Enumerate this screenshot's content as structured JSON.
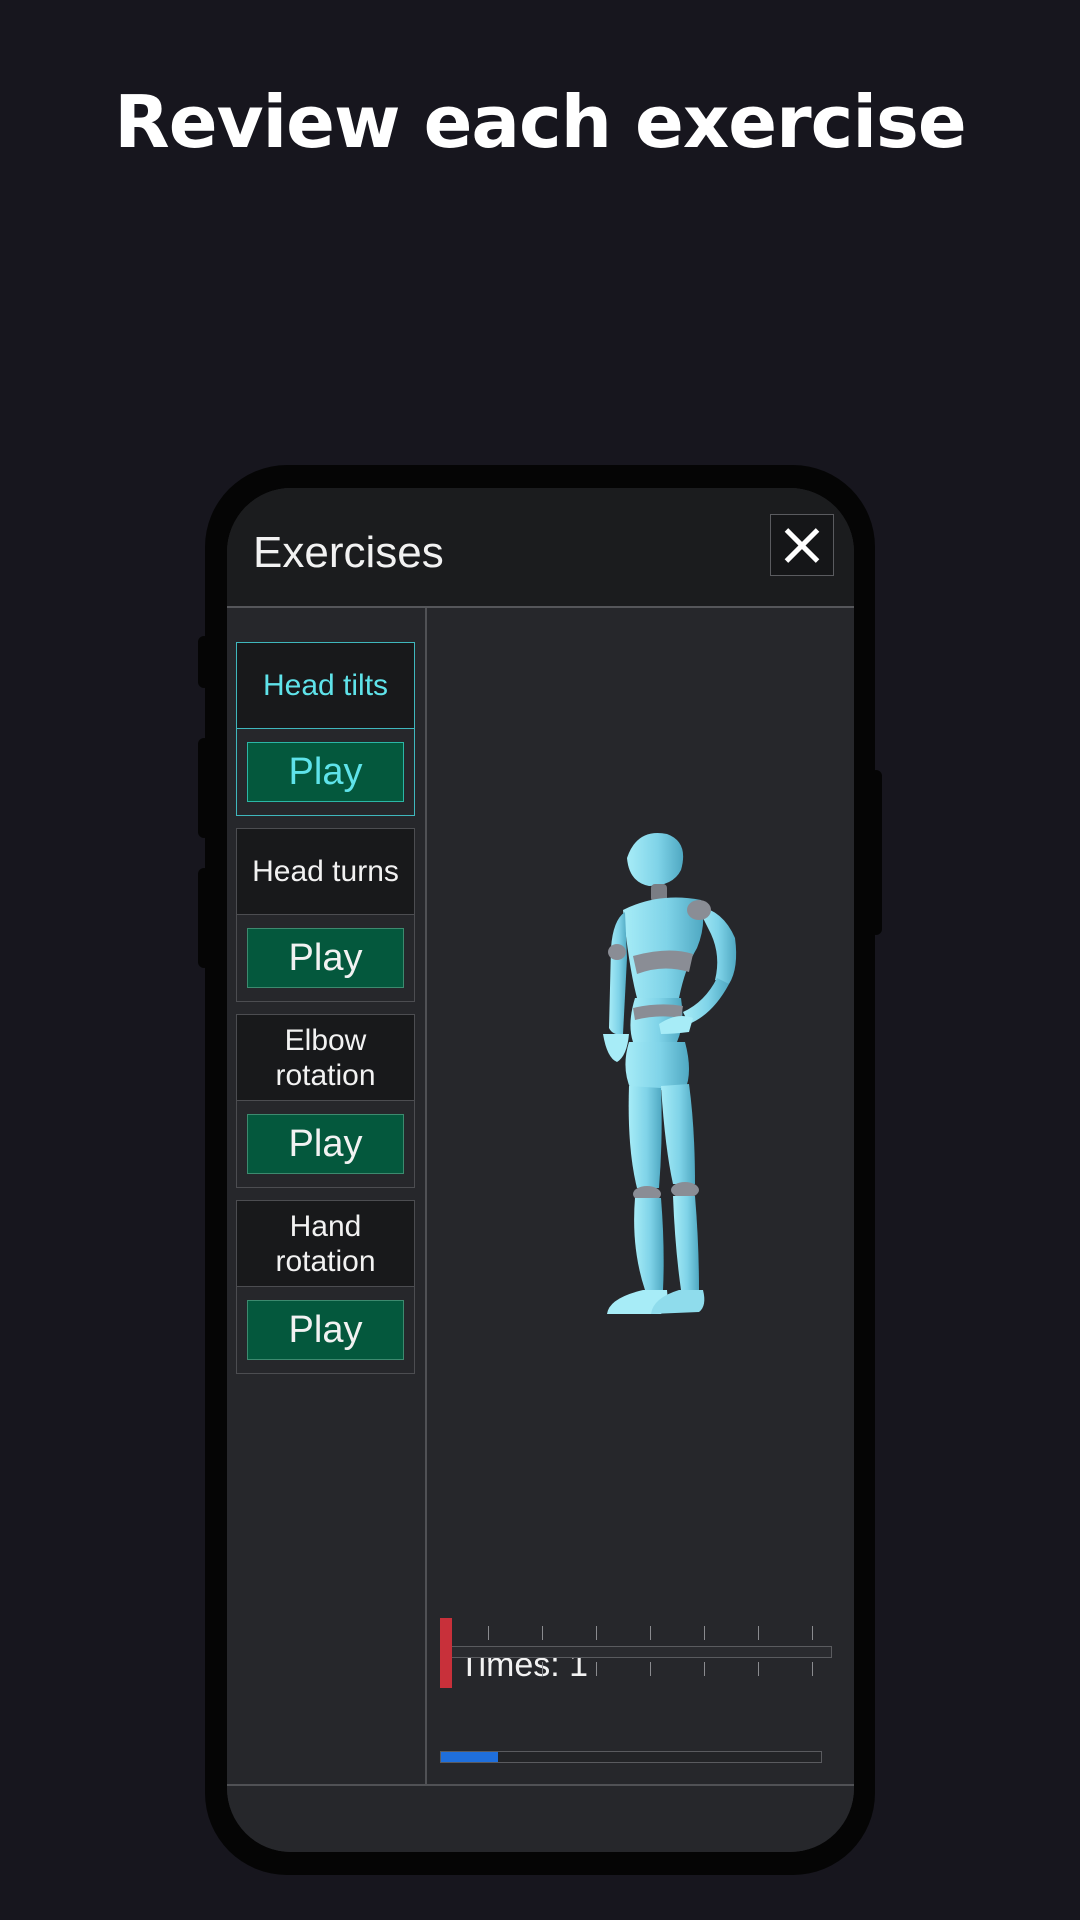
{
  "headline": "Review each exercise",
  "app": {
    "title": "Exercises",
    "close_icon": "close-icon"
  },
  "exercises": [
    {
      "label": "Head tilts",
      "play_label": "Play",
      "active": true
    },
    {
      "label": "Head turns",
      "play_label": "Play",
      "active": false
    },
    {
      "label": "Elbow rotation",
      "play_label": "Play",
      "active": false
    },
    {
      "label": "Hand rotation",
      "play_label": "Play",
      "active": false
    }
  ],
  "viewer": {
    "times_text": "Times: 1",
    "timeline_position": 0.0,
    "progress_fraction": 0.15
  },
  "colors": {
    "accent_active": "#5fe3ea",
    "play_button": "#04583d",
    "scrubber": "#c8303a",
    "progress": "#1f6fdc",
    "figure": "#7fd3e8"
  }
}
